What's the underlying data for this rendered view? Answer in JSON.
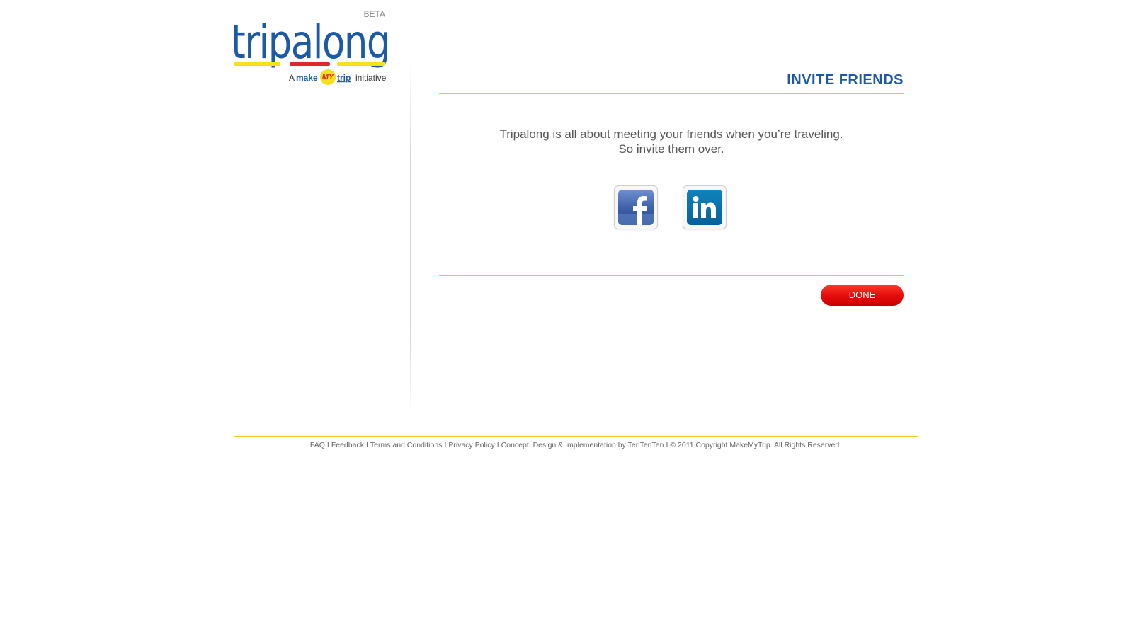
{
  "logo": {
    "wordmark": "tripalong",
    "badge": "BETA",
    "tagline_prefix": "A",
    "tagline_brand_make": "make",
    "tagline_brand_my": "MY",
    "tagline_brand_trip": "trip",
    "tagline_suffix": "initiative",
    "colors": {
      "wordmark": "#1c5aa8",
      "underline_yellow": "#f7e11a",
      "underline_red": "#e3262c"
    }
  },
  "main": {
    "title": "INVITE FRIENDS",
    "intro_line1": "Tripalong is all about meeting your friends when you’re traveling.",
    "intro_line2": "So invite them over.",
    "social": [
      {
        "name": "facebook",
        "icon": "facebook-icon",
        "color": "#3b5998"
      },
      {
        "name": "linkedin",
        "icon": "linkedin-icon",
        "color": "#0e76a8"
      }
    ],
    "done_label": "DONE"
  },
  "footer": {
    "faq": "FAQ",
    "feedback": "Feedback",
    "terms": "Terms and Conditions",
    "privacy": "Privacy Policy",
    "credit_prefix": "Concept, Design & Implementation by",
    "credit_company": "TenTenTen",
    "copyright": "© 2011 Copyright MakeMyTrip. All Rights Reserved.",
    "separator": "I"
  },
  "colors": {
    "accent_yellow": "#f3c623",
    "title_blue": "#1c5aa8",
    "done_red": "#e30b0b"
  }
}
